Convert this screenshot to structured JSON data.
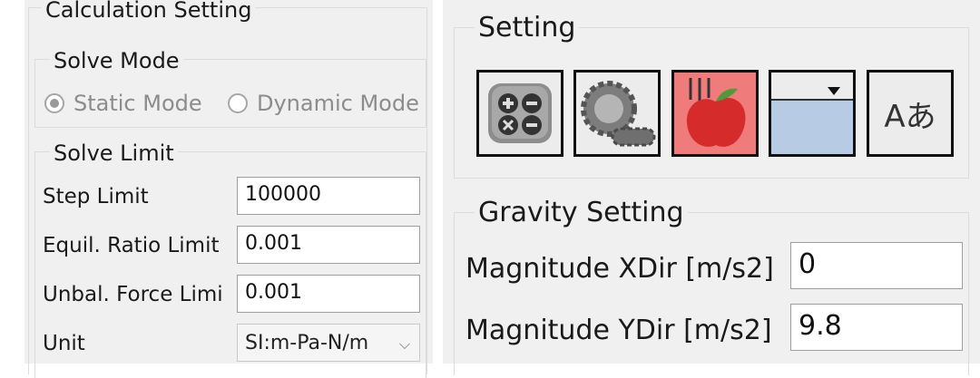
{
  "calculation": {
    "title": "Calculation Setting",
    "solve_mode": {
      "title": "Solve Mode",
      "options": [
        {
          "label": "Static Mode",
          "selected": true
        },
        {
          "label": "Dynamic Mode",
          "selected": false
        }
      ]
    },
    "solve_limit": {
      "title": "Solve Limit",
      "step_limit_label": "Step Limit",
      "step_limit_value": "100000",
      "equil_ratio_label": "Equil. Ratio Limit",
      "equil_ratio_value": "0.001",
      "unbal_force_label": "Unbal. Force Limi",
      "unbal_force_value": "0.001",
      "unit_label": "Unit",
      "unit_value": "SI:m-Pa-N/m"
    }
  },
  "setting": {
    "title": "Setting",
    "icons": [
      "calculator-icon",
      "gear-icon",
      "apple-gravity-icon",
      "water-level-icon",
      "font-icon"
    ],
    "font_icon_text": "Aあ",
    "gravity_button_color": "#f07b7b"
  },
  "gravity": {
    "title": "Gravity Setting",
    "x_label": "Magnitude XDir [m/s2]",
    "x_value": "0",
    "y_label": "Magnitude YDir [m/s2]",
    "y_value": "9.8"
  }
}
